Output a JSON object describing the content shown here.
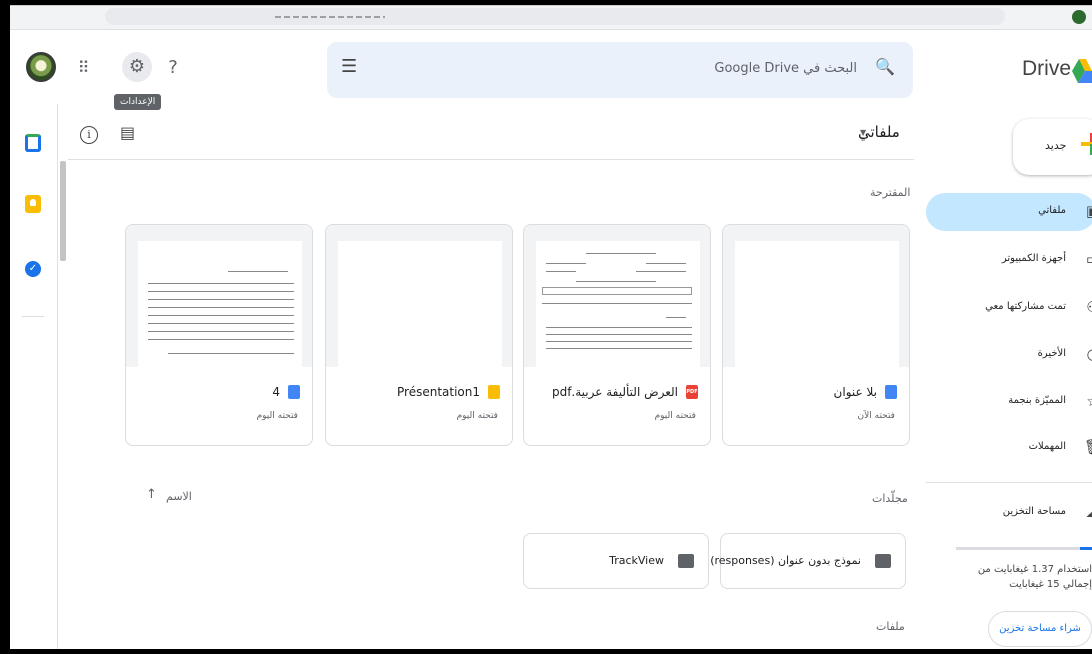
{
  "browser": {
    "profile_color": "#2d6a2d"
  },
  "header": {
    "app_name": "Drive",
    "settings_tooltip": "الإعدادات",
    "search_placeholder": "البحث في Google Drive",
    "icons": [
      "apps-icon",
      "settings-icon",
      "help-icon",
      "filter-icon",
      "search-icon"
    ]
  },
  "sidebar": {
    "new_label": "جديد",
    "items": [
      {
        "label": "ملفاتي",
        "icon": "my-drive-icon",
        "active": true
      },
      {
        "label": "أجهزة الكمبيوتر",
        "icon": "computer-icon"
      },
      {
        "label": "تمت مشاركتها معي",
        "icon": "shared-icon"
      },
      {
        "label": "الأخيرة",
        "icon": "recent-icon"
      },
      {
        "label": "المميّزة بنجمة",
        "icon": "star-icon"
      },
      {
        "label": "المهملات",
        "icon": "trash-icon"
      },
      {
        "label": "مساحة التخزين",
        "icon": "cloud-icon"
      }
    ],
    "storage_text": "استخدام 1.37 غيغابايت من إجمالي 15 غيغابايت",
    "storage_fraction": 0.09,
    "buy_storage": "شراء مساحة تخزين"
  },
  "main": {
    "title": "ملفاتي",
    "suggested_label": "المقترحة",
    "suggested": [
      {
        "name": "بلا عنوان",
        "when": "فتحته الآن",
        "type": "docs"
      },
      {
        "name": "العرض التأليفة عربية.pdf",
        "when": "فتحته اليوم",
        "type": "pdf"
      },
      {
        "name": "Présentation1",
        "when": "فتحته اليوم",
        "type": "slides"
      },
      {
        "name": "4",
        "when": "فتحته اليوم",
        "type": "docs"
      }
    ],
    "sort_label": "الاسم",
    "folders_label": "مجلّدات",
    "folders": [
      {
        "name": "نموذج بدون عنوان (responses) ..."
      },
      {
        "name": "TrackView"
      }
    ],
    "files_label": "ملفات"
  },
  "colors": {
    "accent": "#1a73e8",
    "active_nav": "#c2e7ff",
    "search_bg": "#eaf1fb"
  }
}
